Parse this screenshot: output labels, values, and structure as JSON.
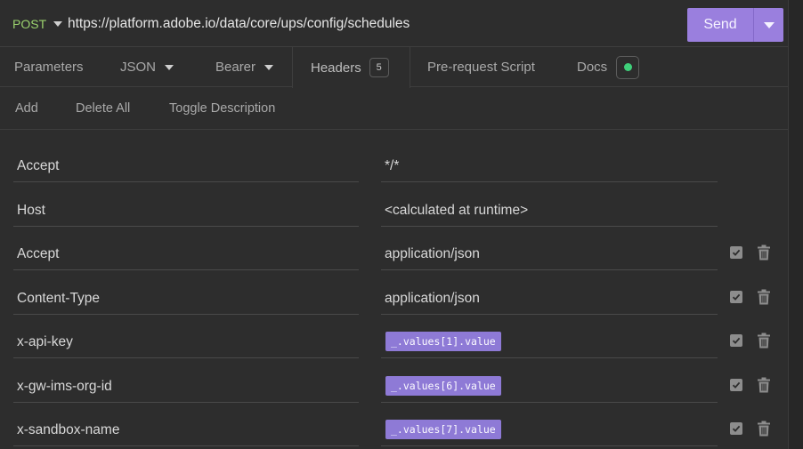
{
  "request": {
    "method": "POST",
    "url": "https://platform.adobe.io/data/core/ups/config/schedules",
    "send_label": "Send",
    "method_color": "#9bd26e",
    "accent_color": "#9a7fde"
  },
  "tabs": [
    {
      "label": "Parameters"
    },
    {
      "label": "JSON"
    },
    {
      "label": "Bearer"
    },
    {
      "label": "Headers",
      "badge": "5",
      "active": true
    },
    {
      "label": "Pre-request Script"
    },
    {
      "label": "Docs",
      "status_color": "#3fd07a"
    }
  ],
  "toolbar": {
    "add_label": "Add",
    "delete_all_label": "Delete All",
    "toggle_description_label": "Toggle Description"
  },
  "headers": [
    {
      "name": "Accept",
      "value": "*/*",
      "kind": "text",
      "controls": false
    },
    {
      "name": "Host",
      "value": "<calculated at runtime>",
      "kind": "text",
      "controls": false
    },
    {
      "name": "Accept",
      "value": "application/json",
      "kind": "text",
      "controls": true,
      "enabled": true
    },
    {
      "name": "Content-Type",
      "value": "application/json",
      "kind": "text",
      "controls": true,
      "enabled": true
    },
    {
      "name": "x-api-key",
      "value": "_.values[1].value",
      "kind": "variable",
      "controls": true,
      "enabled": true
    },
    {
      "name": "x-gw-ims-org-id",
      "value": "_.values[6].value",
      "kind": "variable",
      "controls": true,
      "enabled": true
    },
    {
      "name": "x-sandbox-name",
      "value": "_.values[7].value",
      "kind": "variable",
      "controls": true,
      "enabled": true
    }
  ],
  "icons": {
    "method_dropdown": "chevron-down-icon",
    "send_dropdown": "chevron-down-icon",
    "enable_toggle": "checkbox-icon",
    "delete": "trash-icon"
  }
}
